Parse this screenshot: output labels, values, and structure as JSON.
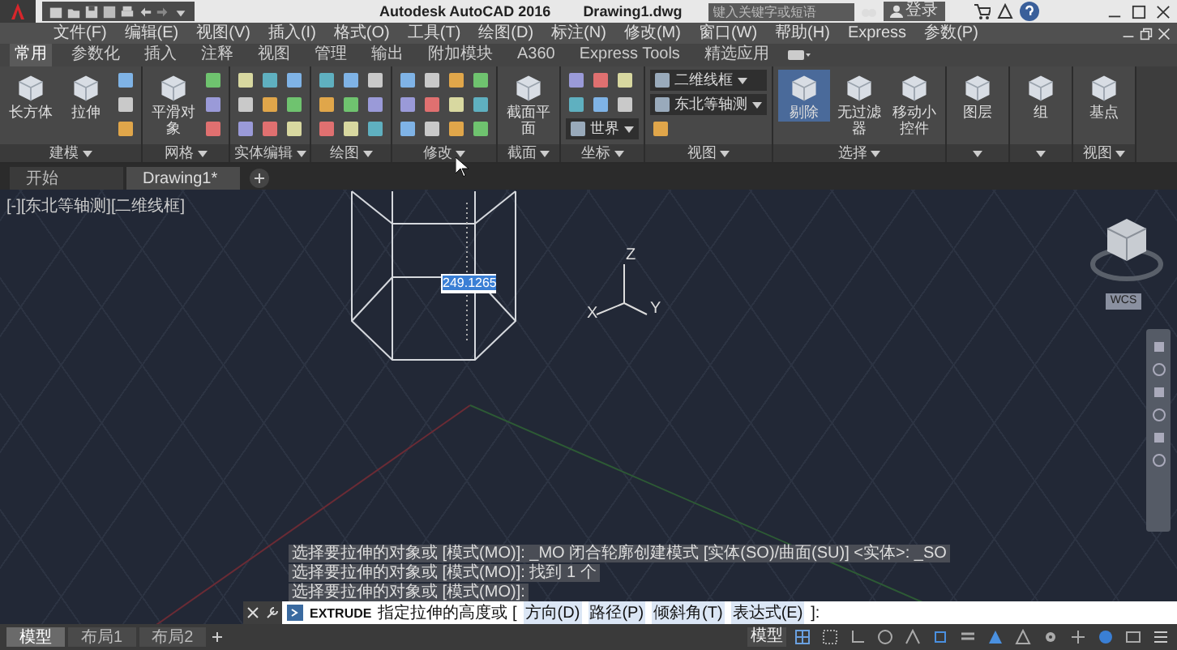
{
  "title_bar": {
    "title": "Autodesk AutoCAD 2016",
    "file": "Drawing1.dwg",
    "search_placeholder": "键入关键字或短语",
    "user": "登录"
  },
  "menu": [
    "文件(F)",
    "编辑(E)",
    "视图(V)",
    "插入(I)",
    "格式(O)",
    "工具(T)",
    "绘图(D)",
    "标注(N)",
    "修改(M)",
    "窗口(W)",
    "帮助(H)",
    "Express",
    "参数(P)"
  ],
  "ribbon_tabs": [
    {
      "label": "常用",
      "selected": true
    },
    {
      "label": "参数化",
      "selected": false
    },
    {
      "label": "插入",
      "selected": false
    },
    {
      "label": "注释",
      "selected": false
    },
    {
      "label": "视图",
      "selected": false
    },
    {
      "label": "管理",
      "selected": false
    },
    {
      "label": "输出",
      "selected": false
    },
    {
      "label": "附加模块",
      "selected": false
    },
    {
      "label": "A360",
      "selected": false
    },
    {
      "label": "Express Tools",
      "selected": false
    },
    {
      "label": "精选应用",
      "selected": false
    }
  ],
  "ribbon_panels": [
    {
      "title": "建模",
      "tools": [
        {
          "kind": "large",
          "label": "长方体",
          "on": false
        },
        {
          "kind": "large",
          "label": "拉伸",
          "on": false
        }
      ]
    },
    {
      "title": "网格",
      "tools": [
        {
          "kind": "large",
          "label": "平滑对象",
          "on": false
        }
      ]
    },
    {
      "title": "实体编辑"
    },
    {
      "title": "绘图"
    },
    {
      "title": "修改"
    },
    {
      "title": "截面",
      "tools": [
        {
          "kind": "large",
          "label": "截面平面",
          "on": false
        }
      ]
    },
    {
      "title": "坐标",
      "tools": [
        {
          "kind": "dropdown",
          "label": "世界"
        }
      ]
    },
    {
      "title": "视图",
      "tools": [
        {
          "kind": "dropdown",
          "label": "二维线框"
        },
        {
          "kind": "dropdown",
          "label": "东北等轴测"
        }
      ]
    },
    {
      "title": "选择",
      "tools": [
        {
          "kind": "large",
          "label": "剔除",
          "on": true
        },
        {
          "kind": "large",
          "label": "无过滤器",
          "on": false
        },
        {
          "kind": "large",
          "label": "移动小控件",
          "on": false
        }
      ]
    },
    {
      "tools": [
        {
          "kind": "large",
          "label": "图层",
          "on": false
        }
      ]
    },
    {
      "tools": [
        {
          "kind": "large",
          "label": "组",
          "on": false
        }
      ]
    },
    {
      "title": "视图",
      "tools": [
        {
          "kind": "large",
          "label": "基点",
          "on": false
        }
      ]
    }
  ],
  "file_tabs": [
    {
      "label": "开始",
      "selected": false
    },
    {
      "label": "Drawing1*",
      "selected": true
    }
  ],
  "viewport": {
    "label": "[-][东北等轴测][二维线框]",
    "dimension_input": "249.1265",
    "axes": [
      "Z",
      "X",
      "Y"
    ],
    "viewcube_label": "WCS"
  },
  "command_history": [
    "选择要拉伸的对象或 [模式(MO)]: _MO 闭合轮廓创建模式 [实体(SO)/曲面(SU)] <实体>: _SO",
    "选择要拉伸的对象或 [模式(MO)]: 找到 1 个",
    "选择要拉伸的对象或 [模式(MO)]:"
  ],
  "command_line": {
    "command": "EXTRUDE",
    "prompt": "指定拉伸的高度或 [",
    "options": [
      "方向(D)",
      "路径(P)",
      "倾斜角(T)",
      "表达式(E)"
    ],
    "end": "]:"
  },
  "layout_tabs": [
    {
      "label": "模型",
      "selected": true
    },
    {
      "label": "布局1",
      "selected": false
    },
    {
      "label": "布局2",
      "selected": false
    }
  ],
  "status_bar": {
    "space": "模型"
  }
}
